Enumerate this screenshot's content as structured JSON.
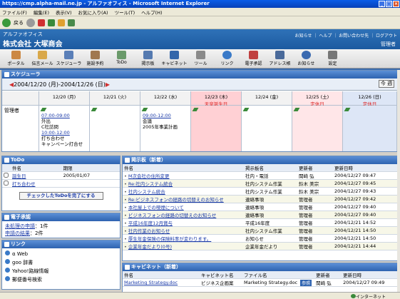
{
  "window": {
    "title": "https://cmp.alpha-mail.ne.jp - アルファオフィス - Microsoft Internet Explorer"
  },
  "menu": [
    "ファイル(F)",
    "編集(E)",
    "表示(V)",
    "お気に入り(A)",
    "ツール(T)",
    "ヘルプ(H)"
  ],
  "toolbar": {
    "back": "戻る"
  },
  "app": {
    "name": "アルファオフィス",
    "company": "株式会社 大塚商会",
    "toplinks": "お知らせ ｜ ヘルプ ｜ お問い合わせ先 ｜ ログアウト",
    "user": "管理者"
  },
  "nav": [
    {
      "label": "ポータル",
      "color": "#c84"
    },
    {
      "label": "伝言メール",
      "color": "#d9a84a"
    },
    {
      "label": "スケジューラ",
      "color": "#5a7fb8"
    },
    {
      "label": "施設予約",
      "color": "#a07850"
    },
    {
      "label": "ToDo",
      "color": "#6a9a6a"
    },
    {
      "label": "掲示板",
      "color": "#557ab0"
    },
    {
      "label": "キャビネット",
      "color": "#3366aa"
    },
    {
      "label": "ツール",
      "color": "#8a8a8a"
    },
    {
      "label": "リンク",
      "color": "#3a7ac8"
    },
    {
      "label": "電子承認",
      "color": "#c04040"
    },
    {
      "label": "アドレス帳",
      "color": "#4a6a9a"
    },
    {
      "label": "お知らせ",
      "color": "#3a6ab0"
    },
    {
      "label": "設定",
      "color": "#777"
    }
  ],
  "schedule": {
    "header": "スケジューラ",
    "range": "2004/12/20 (月)-2004/12/26 (日)",
    "today": "今 週",
    "days": [
      {
        "label": "12/20 (月)",
        "sub": "",
        "bg": "#fff",
        "hd": "#f2f2f2"
      },
      {
        "label": "12/21 (火)",
        "sub": "",
        "bg": "#fff",
        "hd": "#f2f2f2"
      },
      {
        "label": "12/22 (水)",
        "sub": "",
        "bg": "#fff",
        "hd": "#f2f2f2"
      },
      {
        "label": "12/23 (木)",
        "sub": "天皇誕生日",
        "bg": "#ffd0d4",
        "hd": "#ffd0d4"
      },
      {
        "label": "12/24 (金)",
        "sub": "",
        "bg": "#fff",
        "hd": "#f2f2f2"
      },
      {
        "label": "12/25 (土)",
        "sub": "定休日",
        "bg": "#ffe6e8",
        "hd": "#ffe6e8"
      },
      {
        "label": "12/26 (日)",
        "sub": "定休日",
        "bg": "#dde6f6",
        "hd": "#dde6f6"
      }
    ],
    "user": "管理者",
    "events": [
      {
        "day": 0,
        "lines": [
          {
            "t": "07:00-09:00",
            "link": true
          },
          {
            "t": "外出",
            "link": false
          },
          {
            "t": "C社訪問",
            "link": false
          },
          {
            "t": "10:00-12:00",
            "link": true
          },
          {
            "t": "打ち合わせ",
            "link": false
          },
          {
            "t": "キャンペーン打合せ",
            "link": false
          }
        ]
      },
      {
        "day": 2,
        "lines": [
          {
            "t": "09:00-12:00",
            "link": true
          },
          {
            "t": "会議",
            "link": false
          },
          {
            "t": "2005年事業計画",
            "link": false
          }
        ]
      }
    ]
  },
  "todo": {
    "header": "ToDo",
    "col_name": "件名",
    "col_due": "期限",
    "items": [
      {
        "name": "誕生日",
        "due": "2005/01/07"
      },
      {
        "name": "打ち合わせ",
        "due": ""
      }
    ],
    "button": "チェックしたToDoを完了にする"
  },
  "approval": {
    "header": "電子承認",
    "lines": [
      {
        "label": "未処理の申請",
        "count": "：1件"
      },
      {
        "label": "申請の結果",
        "count": "：2件"
      }
    ]
  },
  "links": {
    "header": "リンク",
    "items": [
      "α Web",
      "goo 辞書",
      "Yahoo!路線情報",
      "郵便番号検索"
    ]
  },
  "board": {
    "header": "掲示板（新着）",
    "cols": [
      "件名",
      "掲示板名",
      "更新者",
      "更新日時"
    ],
    "rows": [
      [
        "M次会社の住所変更",
        "社内・電話",
        "関崎 弘",
        "2004/12/27 09:47"
      ],
      [
        "Re:社内システム統合",
        "社内システム作業",
        "鈴木 美宗",
        "2004/12/27 09:45"
      ],
      [
        "社内システム統合",
        "社内システム作業",
        "鈴木 美宗",
        "2004/12/27 09:43"
      ],
      [
        "Re:ビジネスフォンの経路の切替えのお知らせ",
        "連絡事項",
        "管理者",
        "2004/12/27 09:42"
      ],
      [
        "本社屋上での喫煙について",
        "連絡事項",
        "管理者",
        "2004/12/27 09:40"
      ],
      [
        "ビジネスフォンの経路の切替えのお知らせ",
        "連絡事項",
        "管理者",
        "2004/12/27 09:40"
      ],
      [
        "平成16年度12月賞与",
        "平成16年度",
        "管理者",
        "2004/12/21 14:52"
      ],
      [
        "社内作業のお知らせ",
        "社内システム作業",
        "管理者",
        "2004/12/21 14:50"
      ],
      [
        "厚生年金保険の保険料率が変わります。",
        "お知らせ",
        "管理者",
        "2004/12/21 14:50"
      ],
      [
        "企業年金だより(0号)",
        "企業年金だより",
        "管理者",
        "2004/12/21 14:44"
      ]
    ]
  },
  "cabinet": {
    "header": "キャビネット（新着）",
    "cols": [
      "件名",
      "キャビネット名",
      "ファイル名",
      "",
      "更新者",
      "更新日時"
    ],
    "rows": [
      [
        "Marketing Strategy.doc",
        "ビジネス企画案",
        "Marketing Strategy.doc",
        "参照",
        "関崎 弘",
        "2004/12/27 09:49"
      ]
    ]
  },
  "status": {
    "zone": "インターネット"
  }
}
